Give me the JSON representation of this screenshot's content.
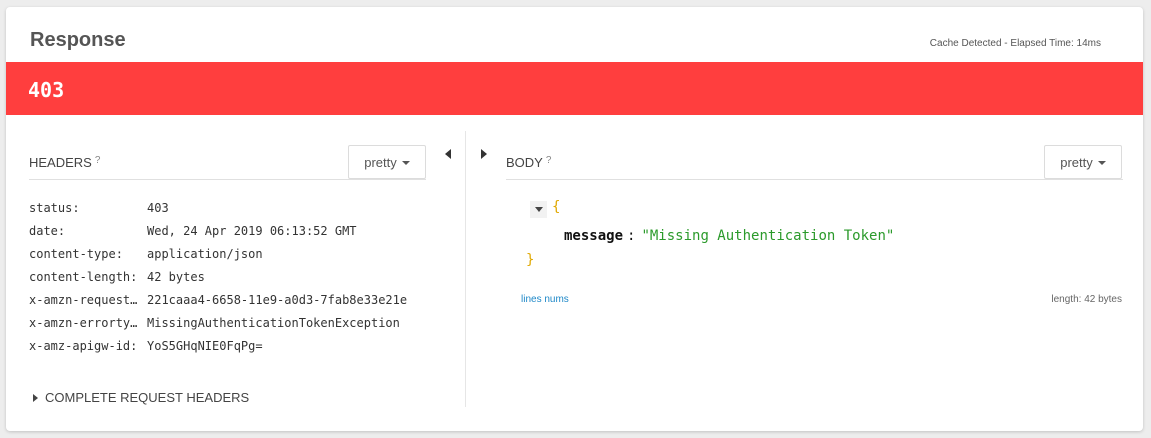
{
  "header": {
    "title": "Response",
    "cache_info": "Cache Detected - Elapsed Time: 14ms"
  },
  "status": {
    "code": "403",
    "color": "#ff3e3e"
  },
  "headers_panel": {
    "title": "HEADERS",
    "help_icon": "?",
    "format_label": "pretty",
    "rows": [
      {
        "key": "status:",
        "value": "403"
      },
      {
        "key": "date:",
        "value": "Wed, 24 Apr 2019 06:13:52 GMT"
      },
      {
        "key": "content-type:",
        "value": "application/json"
      },
      {
        "key": "content-length:",
        "value": "42 bytes"
      },
      {
        "key": "x-amzn-request…",
        "value": "221caaa4-6658-11e9-a0d3-7fab8e33e21e"
      },
      {
        "key": "x-amzn-errorty…",
        "value": "MissingAuthenticationTokenException"
      },
      {
        "key": "x-amz-apigw-id:",
        "value": "YoS5GHqNIE0FqPg="
      }
    ],
    "complete_request_headers": "COMPLETE REQUEST HEADERS"
  },
  "body_panel": {
    "title": "BODY",
    "help_icon": "?",
    "format_label": "pretty",
    "json": {
      "open": "{",
      "key": "message",
      "colon": ":",
      "value": "\"Missing Authentication Token\"",
      "close": "}"
    },
    "lines_nums": "lines nums",
    "length": "length: 42 bytes"
  },
  "colors": {
    "json_string": "#2b9a2b",
    "json_brace": "#e0a800",
    "link": "#1e88c8"
  }
}
